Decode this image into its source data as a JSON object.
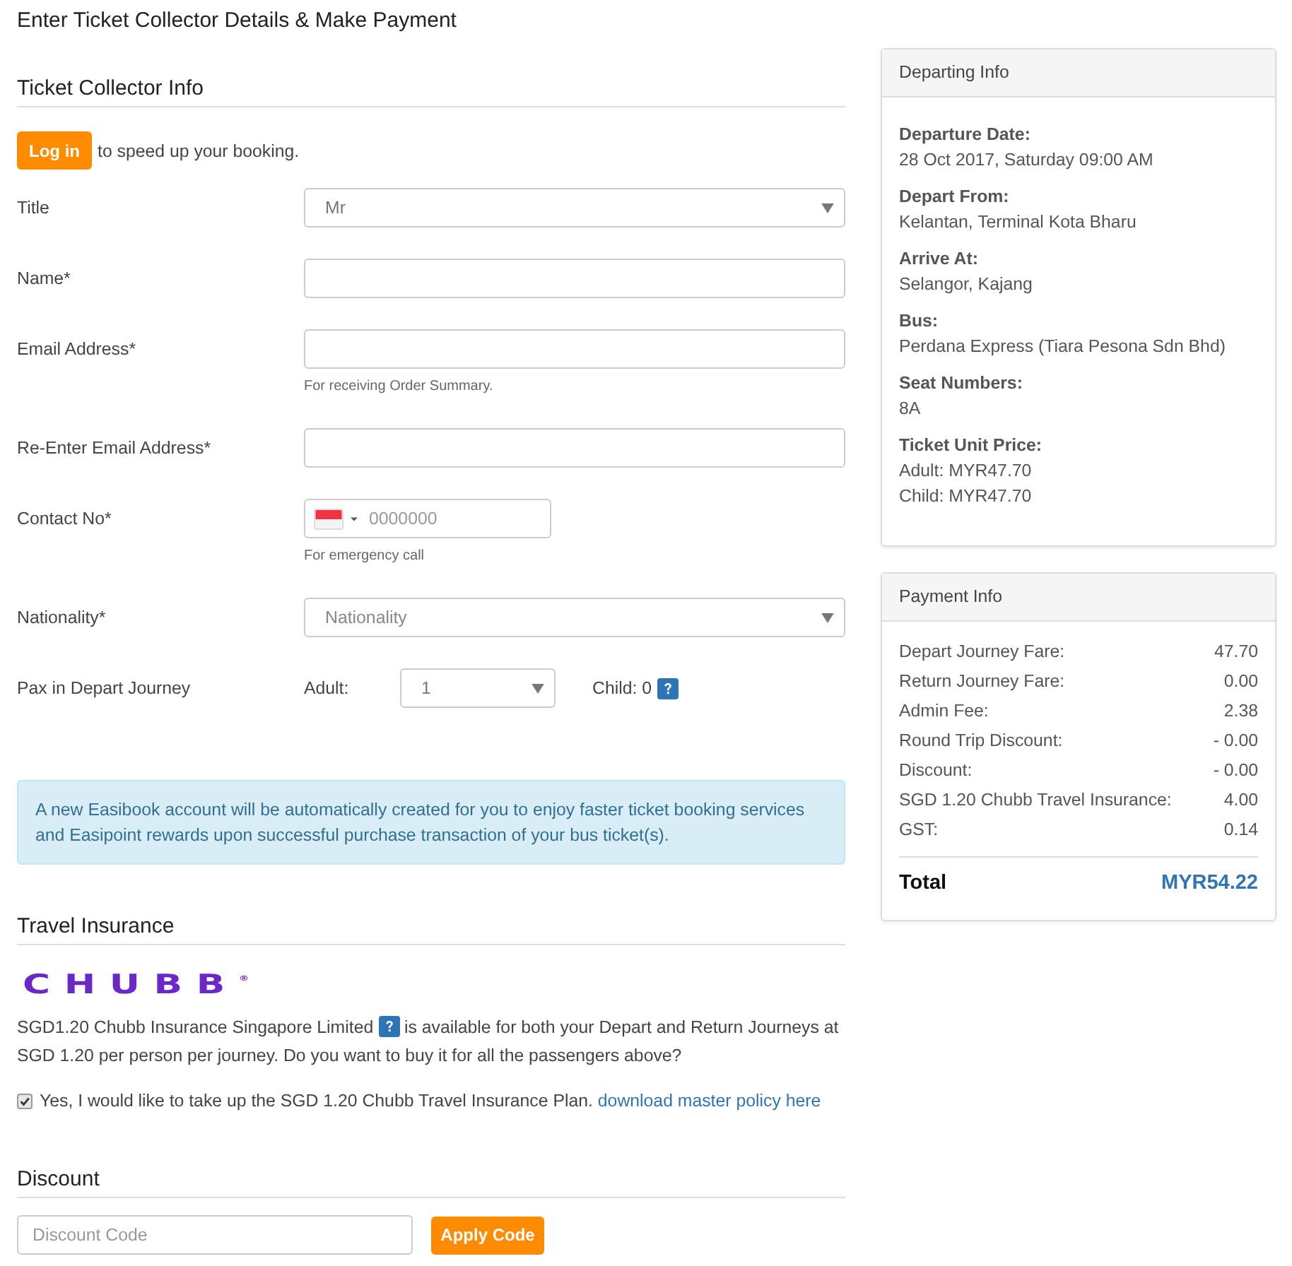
{
  "page_title": "Enter Ticket Collector Details & Make Payment",
  "collector": {
    "heading": "Ticket Collector Info",
    "login_button": "Log in",
    "login_text": "to speed up your booking.",
    "fields": [
      {
        "kind": "select",
        "label": "Title",
        "value": "Mr"
      },
      {
        "kind": "text",
        "label": "Name*"
      },
      {
        "kind": "text",
        "label": "Email Address*",
        "help": "For receiving Order Summary."
      },
      {
        "kind": "text",
        "label": "Re-Enter Email Address*"
      },
      {
        "kind": "phone",
        "label": "Contact No*",
        "placeholder": "0000000",
        "help": "For emergency call"
      },
      {
        "kind": "select",
        "label": "Nationality*",
        "placeholder": "Nationality"
      },
      {
        "kind": "pax",
        "label": "Pax in Depart Journey",
        "adult_label": "Adult:",
        "adult_value": "1",
        "child_text": "Child: 0"
      }
    ]
  },
  "notice": "A new Easibook account will be automatically created for you to enjoy faster ticket booking services and Easipoint rewards upon successful purchase transaction of your bus ticket(s).",
  "insurance": {
    "heading": "Travel Insurance",
    "logo": "CHUBB$^{®}$",
    "text_before": "SGD1.20 Chubb Insurance Singapore Limited",
    "text_after": "is available for both your Depart and Return Journeys at SGD 1.20 per person per journey. Do you want to buy it for all the passengers above?",
    "opt_in": {
      "checked": true,
      "label": "Yes, I would like to take up the SGD 1.20 Chubb Travel Insurance Plan.",
      "link": "download master policy here"
    }
  },
  "discount": {
    "heading": "Discount",
    "placeholder": "Discount Code",
    "button": "Apply Code"
  },
  "departing_info": {
    "heading": "Departing Info",
    "items": [
      {
        "label": "Departure Date:",
        "lines": [
          "28 Oct 2017, Saturday 09:00 AM"
        ]
      },
      {
        "label": "Depart From:",
        "lines": [
          "Kelantan, Terminal Kota Bharu"
        ]
      },
      {
        "label": "Arrive At:",
        "lines": [
          "Selangor, Kajang"
        ]
      },
      {
        "label": "Bus:",
        "lines": [
          "Perdana Express (Tiara Pesona Sdn Bhd)"
        ]
      },
      {
        "label": "Seat Numbers:",
        "lines": [
          "8A"
        ]
      },
      {
        "label": "Ticket Unit Price:",
        "lines": [
          "Adult: MYR47.70",
          "Child: MYR47.70"
        ]
      }
    ]
  },
  "payment_info": {
    "heading": "Payment Info",
    "rows": [
      {
        "label": "Depart Journey Fare:",
        "value": "47.70"
      },
      {
        "label": "Return Journey Fare:",
        "value": "0.00"
      },
      {
        "label": "Admin Fee:",
        "value": "2.38"
      },
      {
        "label": "Round Trip Discount:",
        "value": "- 0.00"
      },
      {
        "label": "Discount:",
        "value": "- 0.00"
      },
      {
        "label": "SGD 1.20 Chubb Travel Insurance:",
        "value": "4.00"
      },
      {
        "label": "GST:",
        "value": "0.14"
      }
    ],
    "total": {
      "label": "Total",
      "value": "MYR54.22"
    }
  }
}
